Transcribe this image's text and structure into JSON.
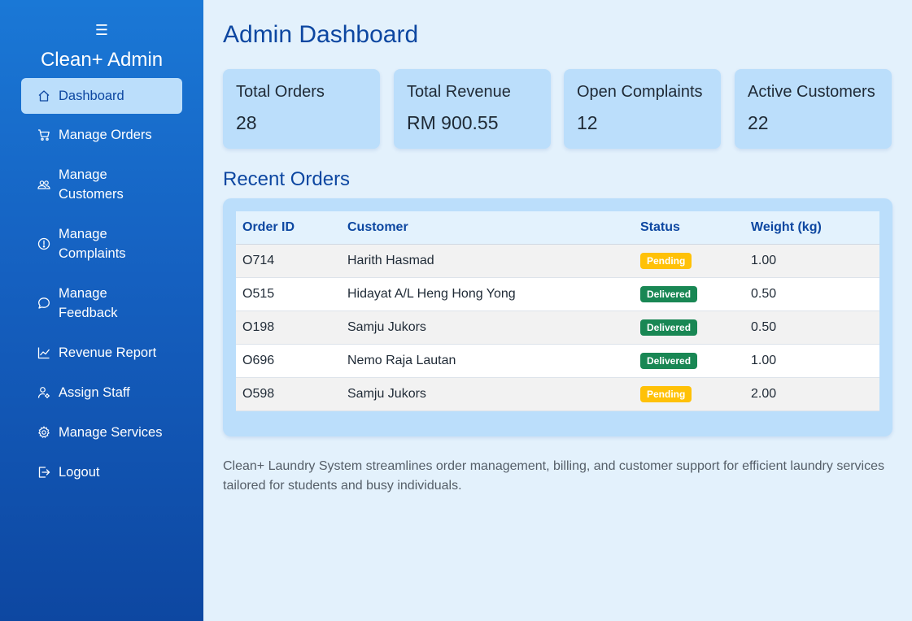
{
  "sidebar": {
    "menu_icon": "☰",
    "brand": "Clean+ Admin",
    "items": [
      {
        "label": "Dashboard",
        "icon": "home-icon",
        "active": true
      },
      {
        "label": "Manage Orders",
        "icon": "cart-icon"
      },
      {
        "label_lines": [
          "Manage",
          "Customers"
        ],
        "icon": "users-icon"
      },
      {
        "label_lines": [
          "Manage",
          "Complaints"
        ],
        "icon": "alert-circle-icon"
      },
      {
        "label_lines": [
          "Manage",
          "Feedback"
        ],
        "icon": "chat-bubble-icon"
      },
      {
        "label": "Revenue Report",
        "icon": "line-chart-icon"
      },
      {
        "label": "Assign Staff",
        "icon": "user-gear-icon"
      },
      {
        "label": "Manage Services",
        "icon": "gear-icon"
      },
      {
        "label": "Logout",
        "icon": "logout-icon"
      }
    ]
  },
  "main": {
    "title": "Admin Dashboard",
    "stats": [
      {
        "label": "Total Orders",
        "value": "28"
      },
      {
        "label": "Total Revenue",
        "value": "RM 900.55"
      },
      {
        "label": "Open Complaints",
        "value": "12"
      },
      {
        "label": "Active Customers",
        "value": "22"
      }
    ],
    "recent_orders": {
      "title": "Recent Orders",
      "columns": [
        "Order ID",
        "Customer",
        "Status",
        "Weight (kg)"
      ],
      "rows": [
        {
          "order_id": "O714",
          "customer": "Harith Hasmad",
          "status": "Pending",
          "weight": "1.00"
        },
        {
          "order_id": "O515",
          "customer": "Hidayat A/L Heng Hong Yong",
          "status": "Delivered",
          "weight": "0.50"
        },
        {
          "order_id": "O198",
          "customer": "Samju Jukors",
          "status": "Delivered",
          "weight": "0.50"
        },
        {
          "order_id": "O696",
          "customer": "Nemo Raja Lautan",
          "status": "Delivered",
          "weight": "1.00"
        },
        {
          "order_id": "O598",
          "customer": "Samju Jukors",
          "status": "Pending",
          "weight": "2.00"
        }
      ]
    },
    "footer": "Clean+ Laundry System streamlines order management, billing, and customer support for efficient laundry services tailored for students and busy individuals."
  },
  "colors": {
    "sidebar_top": "#1a78d6",
    "sidebar_bottom": "#0d47a1",
    "accent": "#0d47a1",
    "card_bg": "#bbdefb",
    "page_bg": "#e3f1fc",
    "pending": "#ffc107",
    "delivered": "#198754"
  }
}
